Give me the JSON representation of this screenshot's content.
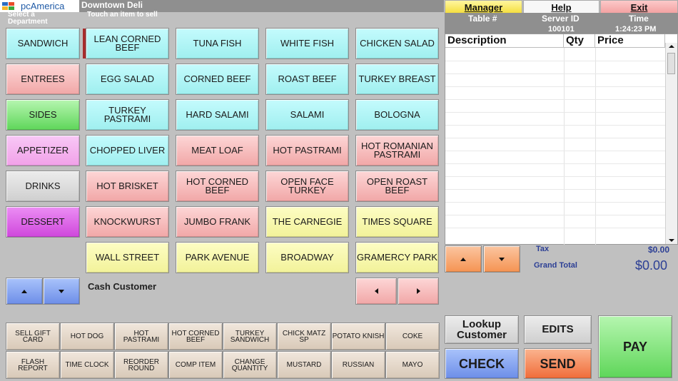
{
  "header": {
    "logo_text": "pcAmerica",
    "store_name": "Downtown Deli",
    "department_label": "Select a Department",
    "items_label": "Touch an item to sell"
  },
  "departments": [
    "SANDWICH",
    "ENTREES",
    "SIDES",
    "APPETIZER",
    "DRINKS",
    "DESSERT"
  ],
  "items": [
    [
      "LEAN CORNED BEEF",
      "TUNA FISH",
      "WHITE FISH",
      "CHICKEN SALAD"
    ],
    [
      "EGG SALAD",
      "CORNED BEEF",
      "ROAST BEEF",
      "TURKEY BREAST"
    ],
    [
      "TURKEY PASTRAMI",
      "HARD SALAMI",
      "SALAMI",
      "BOLOGNA"
    ],
    [
      "CHOPPED LIVER",
      "MEAT LOAF",
      "HOT PASTRAMI",
      "HOT ROMANIAN PASTRAMI"
    ],
    [
      "HOT BRISKET",
      "HOT CORNED BEEF",
      "OPEN FACE TURKEY",
      "OPEN ROAST BEEF"
    ],
    [
      "KNOCKWURST",
      "JUMBO FRANK",
      "THE CARNEGIE",
      "TIMES SQUARE"
    ],
    [
      "WALL STREET",
      "PARK AVENUE",
      "BROADWAY",
      "GRAMERCY PARK"
    ]
  ],
  "customer": "Cash Customer",
  "quick_buttons": [
    [
      "SELL GIFT CARD",
      "HOT DOG",
      "HOT PASTRAMI",
      "HOT CORNED BEEF",
      "TURKEY SANDWICH",
      "CHICK MATZ SP",
      "POTATO KNISH",
      "COKE"
    ],
    [
      "FLASH REPORT",
      "TIME CLOCK",
      "REORDER ROUND",
      "COMP ITEM",
      "CHANGE QUANTITY",
      "MUSTARD",
      "RUSSIAN",
      "MAYO"
    ]
  ],
  "top_menu": {
    "manager": "Manager",
    "help": "Help",
    "exit": "Exit"
  },
  "order_info": {
    "table_label": "Table #",
    "server_label": "Server ID",
    "time_label": "Time",
    "server_id": "100101",
    "time": "1:24:23 PM"
  },
  "order_columns": [
    "Description",
    "Qty",
    "Price"
  ],
  "totals": {
    "tax_label": "Tax",
    "tax_value": "$0.00",
    "grand_label": "Grand Total",
    "grand_value": "$0.00"
  },
  "actions": {
    "lookup": "Lookup Customer",
    "edits": "EDITS",
    "pay": "PAY",
    "check": "CHECK",
    "send": "SEND"
  },
  "colors": {
    "item_cyan": "#aef4f5",
    "item_red": "#f5b7b7",
    "item_yellow": "#f7f7a8",
    "sides_green": "#7be274",
    "dessert_magenta": "#d557e2",
    "pay_green": "#5fd65a",
    "check_blue": "#6d8ee8",
    "send_orange": "#f59453"
  }
}
